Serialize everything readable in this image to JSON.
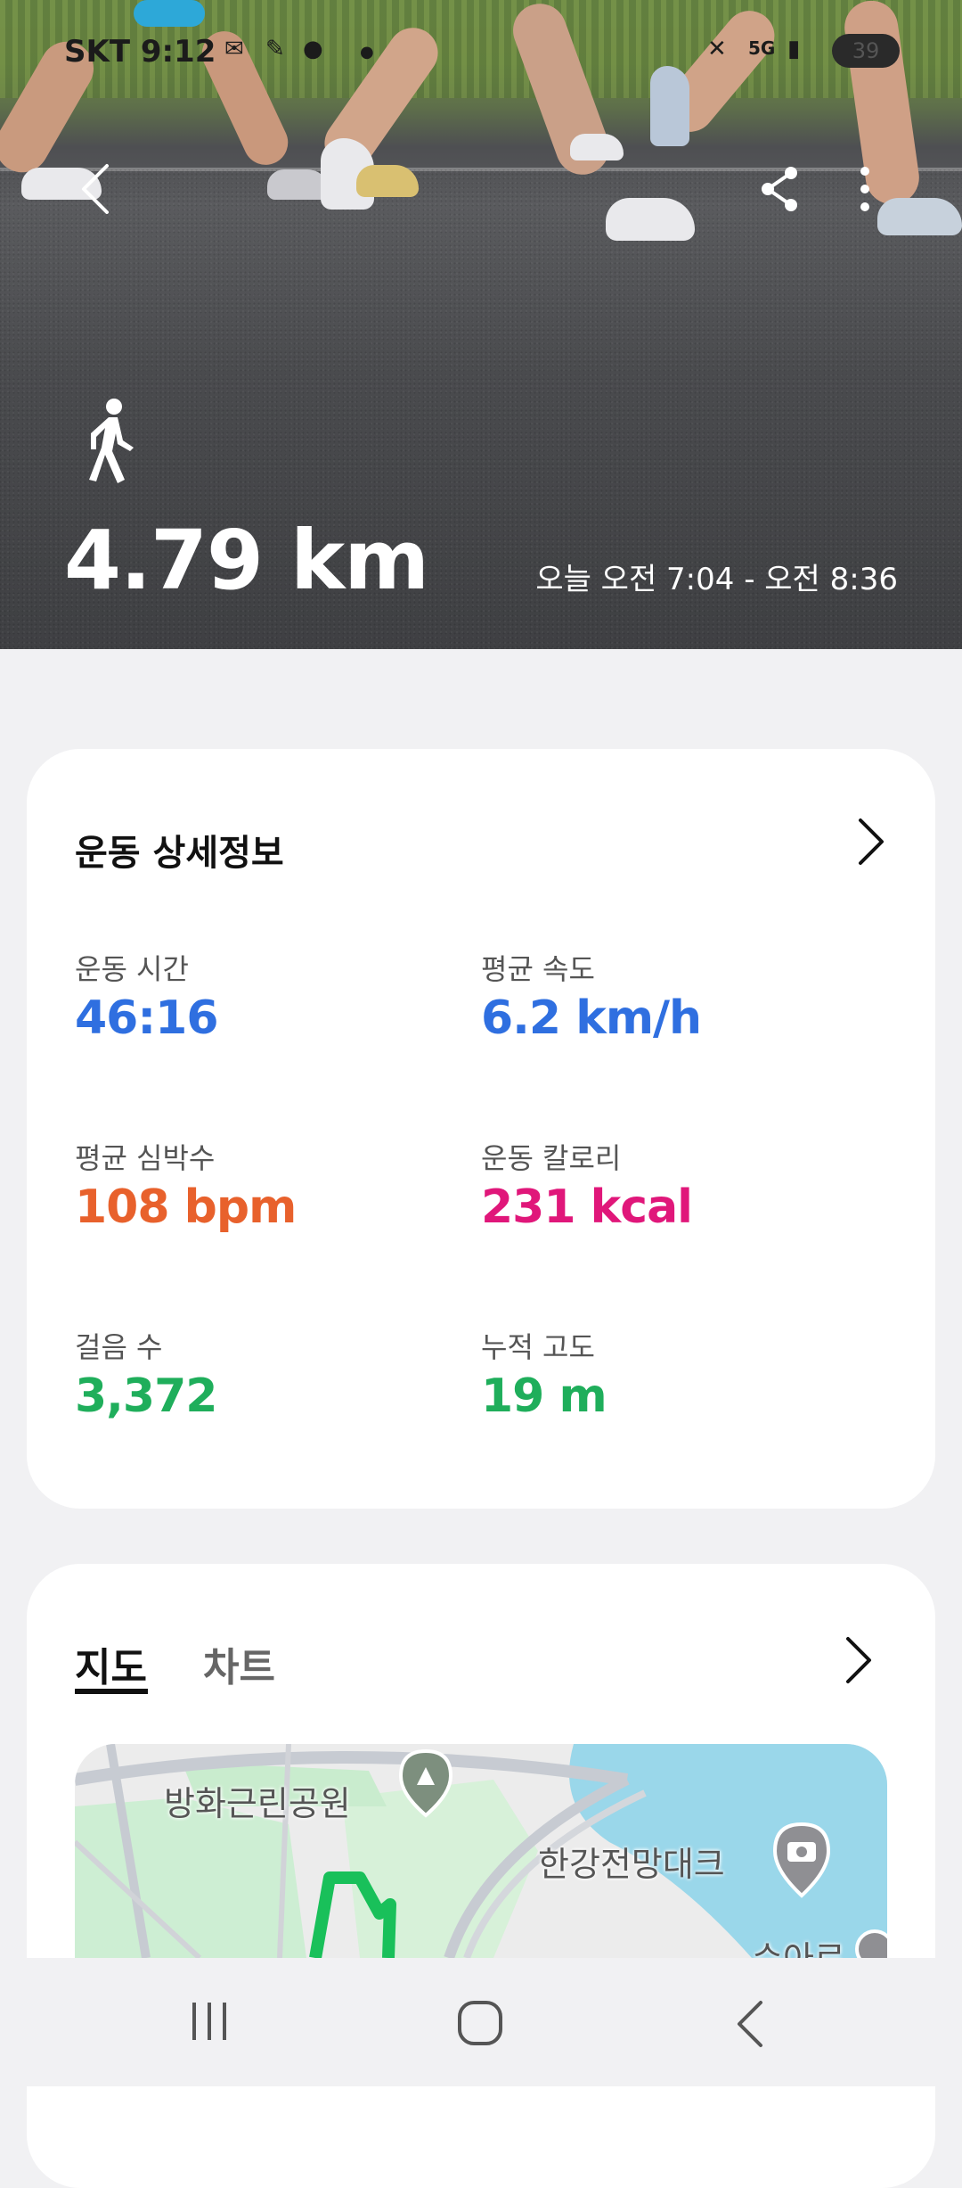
{
  "status_bar": {
    "carrier": "SKT",
    "time": "9:12",
    "battery": "39"
  },
  "hero": {
    "distance": "4.79 km",
    "time_range": "오늘 오전 7:04 - 오전 8:36",
    "activity_icon": "walking-person-icon"
  },
  "details_card": {
    "title": "운동 상세정보",
    "stats": [
      {
        "label": "운동 시간",
        "value": "46:16",
        "unit": "",
        "color": "#2f6fe0"
      },
      {
        "label": "평균 속도",
        "value": "6.2",
        "unit": "km/h",
        "color": "#2f6fe0"
      },
      {
        "label": "평균 심박수",
        "value": "108",
        "unit": "bpm",
        "color": "#e8612c"
      },
      {
        "label": "운동 칼로리",
        "value": "231",
        "unit": "kcal",
        "color": "#e0177a"
      },
      {
        "label": "걸음 수",
        "value": "3,372",
        "unit": "",
        "color": "#1fae5b"
      },
      {
        "label": "누적 고도",
        "value": "19",
        "unit": "m",
        "color": "#1fae5b"
      }
    ]
  },
  "map_card": {
    "tabs": [
      {
        "label": "지도",
        "selected": true
      },
      {
        "label": "차트",
        "selected": false
      }
    ],
    "places": {
      "park": "방화근린공원",
      "deck": "한강전망대크",
      "partial": "수아르"
    }
  },
  "colors": {
    "blue": "#2f6fe0",
    "orange": "#e8612c",
    "pink": "#e0177a",
    "green": "#1fae5b",
    "route": "#19c05a"
  }
}
